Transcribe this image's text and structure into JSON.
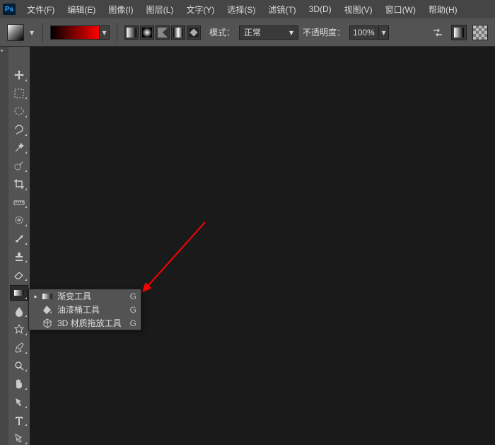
{
  "app_logo": "Ps",
  "menubar": {
    "items": [
      "文件(F)",
      "编辑(E)",
      "图像(I)",
      "图层(L)",
      "文字(Y)",
      "选择(S)",
      "滤镜(T)",
      "3D(D)",
      "视图(V)",
      "窗口(W)",
      "帮助(H)"
    ]
  },
  "optionsbar": {
    "mode_label": "模式：",
    "mode_value": "正常",
    "opacity_label": "不透明度：",
    "opacity_value": "100%"
  },
  "toolbar": {
    "tools": [
      {
        "name": "move-tool",
        "icon": "move"
      },
      {
        "name": "rectangular-marquee-tool",
        "icon": "marquee"
      },
      {
        "name": "elliptical-marquee-tool",
        "icon": "ellipse"
      },
      {
        "name": "lasso-tool",
        "icon": "lasso"
      },
      {
        "name": "magic-wand-tool",
        "icon": "wand"
      },
      {
        "name": "quick-selection-tool",
        "icon": "qsel"
      },
      {
        "name": "crop-tool",
        "icon": "crop"
      },
      {
        "name": "ruler-tool",
        "icon": "ruler"
      },
      {
        "name": "spot-healing-tool",
        "icon": "heal"
      },
      {
        "name": "brush-tool",
        "icon": "brush"
      },
      {
        "name": "clone-stamp-tool",
        "icon": "stamp"
      },
      {
        "name": "eraser-tool",
        "icon": "eraser"
      },
      {
        "name": "gradient-tool",
        "icon": "gradient",
        "active": true
      },
      {
        "name": "blur-tool",
        "icon": "blur"
      },
      {
        "name": "dodge-tool",
        "icon": "dodge"
      },
      {
        "name": "pen-tool",
        "icon": "pen"
      },
      {
        "name": "zoom-tool",
        "icon": "zoom"
      },
      {
        "name": "hand-tool",
        "icon": "hand"
      },
      {
        "name": "path-selection-tool",
        "icon": "pathsel"
      },
      {
        "name": "type-tool",
        "icon": "type"
      },
      {
        "name": "direct-selection-tool",
        "icon": "dsel"
      }
    ]
  },
  "flyout": {
    "items": [
      {
        "label": "渐变工具",
        "shortcut": "G",
        "active": true,
        "icon": "gradient"
      },
      {
        "label": "油漆桶工具",
        "shortcut": "G",
        "active": false,
        "icon": "bucket"
      },
      {
        "label": "3D 材质拖放工具",
        "shortcut": "G",
        "active": false,
        "icon": "3dmat"
      }
    ]
  },
  "annotation": {
    "type": "arrow",
    "color": "#ff0000"
  }
}
